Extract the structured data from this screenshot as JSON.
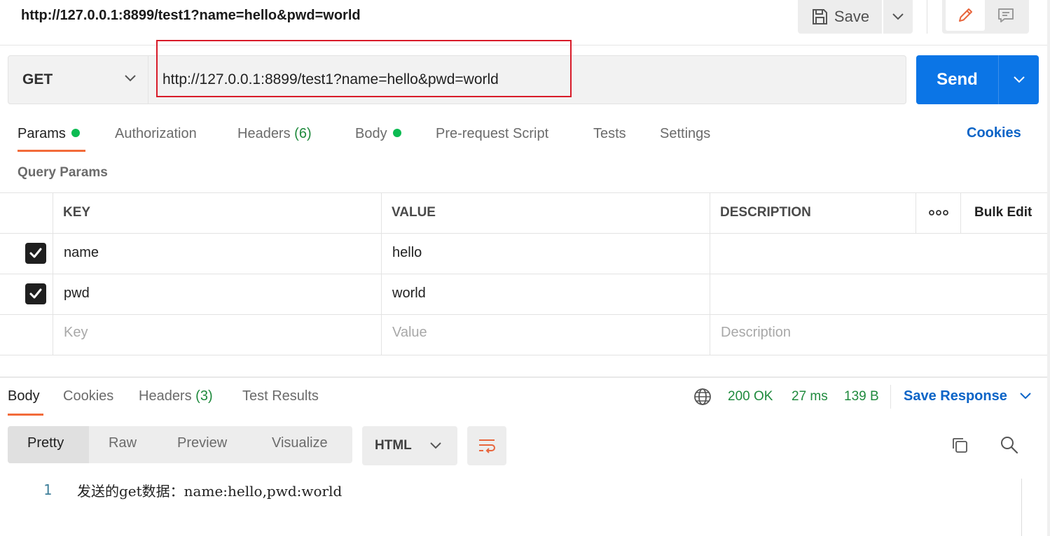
{
  "header": {
    "title": "http://127.0.0.1:8899/test1?name=hello&pwd=world",
    "save_label": "Save"
  },
  "request": {
    "method": "GET",
    "url": "http://127.0.0.1:8899/test1?name=hello&pwd=world",
    "send_label": "Send"
  },
  "tabs": {
    "params": "Params",
    "authorization": "Authorization",
    "headers": "Headers",
    "headers_count": "(6)",
    "body": "Body",
    "prerequest": "Pre-request Script",
    "tests": "Tests",
    "settings": "Settings",
    "cookies": "Cookies"
  },
  "query": {
    "title": "Query Params",
    "columns": {
      "key": "KEY",
      "value": "VALUE",
      "description": "DESCRIPTION",
      "bulk_edit": "Bulk Edit"
    },
    "rows": [
      {
        "checked": true,
        "key": "name",
        "value": "hello",
        "description": ""
      },
      {
        "checked": true,
        "key": "pwd",
        "value": "world",
        "description": ""
      }
    ],
    "placeholders": {
      "key": "Key",
      "value": "Value",
      "description": "Description"
    }
  },
  "response": {
    "tabs": {
      "body": "Body",
      "cookies": "Cookies",
      "headers": "Headers",
      "headers_count": "(3)",
      "test_results": "Test Results"
    },
    "status": "200 OK",
    "time": "27 ms",
    "size": "139 B",
    "save_response": "Save Response",
    "formats": {
      "pretty": "Pretty",
      "raw": "Raw",
      "preview": "Preview",
      "visualize": "Visualize"
    },
    "language": "HTML",
    "lines": [
      {
        "number": "1",
        "text": "发送的get数据：name:hello,pwd:world"
      }
    ]
  },
  "colors": {
    "accent_orange": "#f26b3a",
    "send_blue": "#0b75e6",
    "link_blue": "#0b64c7",
    "status_green": "#1f8a3d",
    "dot_green": "#0cbb52",
    "highlight_red": "#d81b29"
  }
}
